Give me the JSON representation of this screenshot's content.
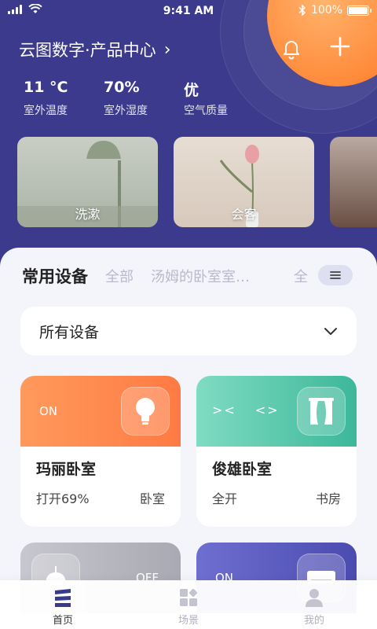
{
  "status_bar": {
    "time": "9:41 AM",
    "battery": "100%",
    "battery_level": 1.0
  },
  "header": {
    "title": "云图数字·产品中心",
    "title_chevron": "›"
  },
  "weather": [
    {
      "value": "11 °C",
      "label": "室外温度"
    },
    {
      "value": "70%",
      "label": "室外湿度"
    },
    {
      "value": "优",
      "label": "空气质量"
    }
  ],
  "scenes": [
    {
      "label": "洗漱"
    },
    {
      "label": "会客"
    },
    {
      "label": ""
    }
  ],
  "tabs": {
    "items": [
      "常用设备",
      "全部",
      "汤姆的卧室室…"
    ],
    "all_label": "全"
  },
  "filter": {
    "selected": "所有设备"
  },
  "devices": [
    {
      "state": "ON",
      "name": "玛丽卧室",
      "status": "打开69%",
      "room": "卧室",
      "icon": "bulb-icon",
      "color": "#ff8a4c"
    },
    {
      "state": "",
      "name": "俊雄卧室",
      "status": "全开",
      "room": "书房",
      "icon": "curtain-icon",
      "color": "#4cc2a6"
    },
    {
      "state": "OFF",
      "name": "",
      "status": "",
      "room": "",
      "icon": "lamp-icon",
      "color": "#b3b3bd"
    },
    {
      "state": "ON",
      "name": "",
      "status": "",
      "room": "",
      "icon": "air-conditioner-icon",
      "color": "#5a5bc0"
    }
  ],
  "bottom_nav": [
    {
      "label": "首页",
      "icon": "home-icon",
      "active": true
    },
    {
      "label": "场景",
      "icon": "scene-grid-icon",
      "active": false
    },
    {
      "label": "我的",
      "icon": "user-icon",
      "active": false
    }
  ],
  "colors": {
    "header_bg": "#3b3a8c",
    "accent_orange": "#ff8a3a",
    "panel_bg": "#f4f4fb"
  }
}
